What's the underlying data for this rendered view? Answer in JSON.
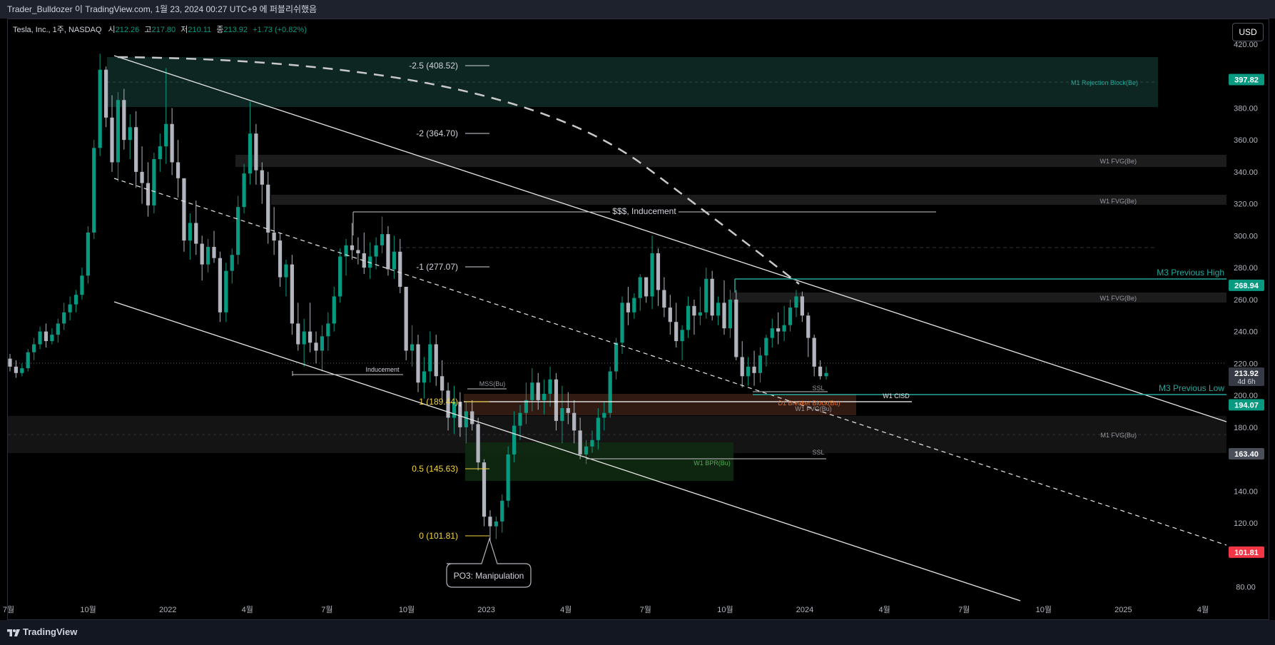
{
  "window": {
    "title": "Trader_Bulldozer 이 TradingView.com, 1월 23, 2024 00:27 UTC+9 에 퍼블리쉬했음"
  },
  "branding": {
    "logo_text": "TradingView"
  },
  "currency_button": "USD",
  "colors": {
    "up": "#089981",
    "down": "#b2b5be",
    "teal": "#26a69a",
    "fib": "#f5d442",
    "white_line": "#e6e6e6",
    "red_label": "#f23645",
    "grey_label": "#6a6d78"
  },
  "chart_data": {
    "type": "candlestick",
    "symbol_line": {
      "name": "Tesla, Inc., 1주, NASDAQ",
      "o_label": "시",
      "o_value": "212.26",
      "h_label": "고",
      "h_value": "217.80",
      "l_label": "저",
      "l_value": "210.11",
      "c_label": "종",
      "c_value": "213.92",
      "change": "+1.73 (+0.82%)"
    },
    "ylim": [
      70,
      428
    ],
    "y_ticks": [
      "420.00",
      "380.00",
      "360.00",
      "340.00",
      "320.00",
      "300.00",
      "280.00",
      "260.00",
      "240.00",
      "220.00",
      "200.00",
      "180.00",
      "140.00",
      "120.00",
      "80.00"
    ],
    "x_ticks": [
      "7월",
      "10월",
      "2022",
      "4월",
      "7월",
      "10월",
      "2023",
      "4월",
      "7월",
      "10월",
      "2024",
      "4월",
      "7월",
      "10월",
      "2025",
      "4월"
    ],
    "price_labels": [
      {
        "text": "397.82",
        "value": 397.82,
        "color": "#089981"
      },
      {
        "text": "268.94",
        "value": 268.94,
        "color": "#089981"
      },
      {
        "text": "213.92",
        "value": 213.92,
        "color": "#363a45",
        "sub": "4d 6h"
      },
      {
        "text": "194.07",
        "value": 194.07,
        "color": "#089981"
      },
      {
        "text": "163.40",
        "value": 163.4,
        "color": "#4a4e59"
      },
      {
        "text": "101.81",
        "value": 101.81,
        "color": "#f23645"
      }
    ],
    "fib_labels": [
      {
        "text": "-2.5 (408.52)",
        "value": 408.52,
        "color": "#d1d4dc"
      },
      {
        "text": "-2 (364.70)",
        "value": 364.7,
        "color": "#d1d4dc"
      },
      {
        "text": "-1 (277.07)",
        "value": 277.07,
        "color": "#d1d4dc"
      },
      {
        "text": "1 (189.44)",
        "value": 189.44,
        "color": "#f5d442"
      },
      {
        "text": "0.5 (145.63)",
        "value": 145.63,
        "color": "#f5d442"
      },
      {
        "text": "0 (101.81)",
        "value": 101.81,
        "color": "#f5d442"
      }
    ],
    "annotations": {
      "m1_rejection": "M1 Rejection Block(Be)",
      "w1_fvg_be": "W1 FVG(Be)",
      "sss_inducement": "$$$, Inducement",
      "m3_prev_high": "M3 Previous High",
      "m3_prev_low": "M3 Previous Low",
      "inducement": "Inducement",
      "mss_bu": "MSS(Bu)",
      "ssl": "SSL",
      "w1_cisd": "W1 CISD",
      "d1_breaker": "D1 Breaker Block(Bu)",
      "w1_fvg_bu": "W1 FVG(Bu)",
      "m1_fvg_bu": "M1 FVG(Bu)",
      "w1_bpr_bu": "W1 BPR(Bu)",
      "po3": "PO3: Manipulation"
    },
    "candles": [
      [
        223,
        226,
        215,
        218
      ],
      [
        218,
        222,
        211,
        214
      ],
      [
        214,
        220,
        212,
        217
      ],
      [
        217,
        229,
        215,
        227
      ],
      [
        227,
        236,
        222,
        232
      ],
      [
        232,
        243,
        229,
        240
      ],
      [
        240,
        245,
        230,
        234
      ],
      [
        234,
        242,
        232,
        238
      ],
      [
        238,
        248,
        233,
        245
      ],
      [
        245,
        258,
        241,
        252
      ],
      [
        252,
        262,
        247,
        257
      ],
      [
        257,
        266,
        252,
        263
      ],
      [
        263,
        280,
        260,
        275
      ],
      [
        275,
        306,
        270,
        302
      ],
      [
        302,
        360,
        298,
        355
      ],
      [
        355,
        414,
        350,
        404
      ],
      [
        404,
        406,
        368,
        374
      ],
      [
        374,
        388,
        340,
        346
      ],
      [
        346,
        390,
        334,
        385
      ],
      [
        385,
        392,
        354,
        360
      ],
      [
        360,
        376,
        348,
        368
      ],
      [
        368,
        378,
        330,
        340
      ],
      [
        340,
        356,
        320,
        333
      ],
      [
        333,
        346,
        312,
        319
      ],
      [
        319,
        352,
        314,
        348
      ],
      [
        348,
        364,
        340,
        356
      ],
      [
        356,
        405,
        345,
        370
      ],
      [
        370,
        380,
        338,
        346
      ],
      [
        346,
        360,
        324,
        336
      ],
      [
        336,
        318,
        290,
        297
      ],
      [
        297,
        314,
        285,
        308
      ],
      [
        308,
        322,
        288,
        295
      ],
      [
        295,
        300,
        272,
        282
      ],
      [
        282,
        298,
        277,
        293
      ],
      [
        293,
        303,
        283,
        286
      ],
      [
        286,
        290,
        246,
        252
      ],
      [
        252,
        283,
        246,
        278
      ],
      [
        278,
        292,
        270,
        288
      ],
      [
        288,
        325,
        282,
        318
      ],
      [
        318,
        345,
        314,
        339
      ],
      [
        339,
        384,
        332,
        364
      ],
      [
        364,
        370,
        332,
        341
      ],
      [
        341,
        346,
        320,
        332
      ],
      [
        332,
        340,
        295,
        302
      ],
      [
        302,
        318,
        288,
        297
      ],
      [
        297,
        302,
        268,
        274
      ],
      [
        274,
        285,
        262,
        282
      ],
      [
        282,
        288,
        238,
        245
      ],
      [
        245,
        258,
        228,
        232
      ],
      [
        232,
        248,
        218,
        240
      ],
      [
        240,
        258,
        227,
        233
      ],
      [
        233,
        240,
        220,
        228
      ],
      [
        228,
        244,
        215,
        237
      ],
      [
        237,
        252,
        228,
        245
      ],
      [
        245,
        268,
        240,
        262
      ],
      [
        262,
        292,
        258,
        287
      ],
      [
        287,
        298,
        275,
        294
      ],
      [
        294,
        308,
        285,
        291
      ],
      [
        291,
        299,
        282,
        289
      ],
      [
        289,
        302,
        276,
        280
      ],
      [
        280,
        296,
        273,
        287
      ],
      [
        287,
        299,
        279,
        294
      ],
      [
        294,
        312,
        289,
        301
      ],
      [
        301,
        306,
        275,
        279
      ],
      [
        279,
        300,
        273,
        290
      ],
      [
        290,
        298,
        264,
        268
      ],
      [
        268,
        256,
        222,
        228
      ],
      [
        228,
        244,
        218,
        232
      ],
      [
        232,
        238,
        202,
        208
      ],
      [
        208,
        224,
        198,
        215
      ],
      [
        215,
        240,
        208,
        232
      ],
      [
        232,
        238,
        206,
        212
      ],
      [
        212,
        222,
        196,
        203
      ],
      [
        203,
        208,
        178,
        186
      ],
      [
        186,
        206,
        176,
        196
      ],
      [
        196,
        202,
        174,
        180
      ],
      [
        180,
        196,
        170,
        190
      ],
      [
        190,
        197,
        178,
        182
      ],
      [
        182,
        186,
        153,
        158
      ],
      [
        158,
        160,
        118,
        124
      ],
      [
        124,
        128,
        108,
        118
      ],
      [
        118,
        124,
        110,
        121
      ],
      [
        121,
        138,
        114,
        134
      ],
      [
        134,
        168,
        130,
        163
      ],
      [
        163,
        190,
        158,
        181
      ],
      [
        181,
        194,
        172,
        189
      ],
      [
        189,
        208,
        182,
        197
      ],
      [
        197,
        217,
        190,
        208
      ],
      [
        208,
        214,
        191,
        197
      ],
      [
        197,
        210,
        188,
        201
      ],
      [
        201,
        218,
        193,
        210
      ],
      [
        210,
        214,
        178,
        184
      ],
      [
        184,
        206,
        170,
        192
      ],
      [
        192,
        202,
        182,
        189
      ],
      [
        189,
        197,
        170,
        178
      ],
      [
        178,
        186,
        160,
        163
      ],
      [
        163,
        172,
        157,
        168
      ],
      [
        168,
        178,
        164,
        172
      ],
      [
        172,
        192,
        166,
        186
      ],
      [
        186,
        196,
        178,
        189
      ],
      [
        189,
        218,
        186,
        215
      ],
      [
        215,
        236,
        210,
        233
      ],
      [
        233,
        262,
        226,
        258
      ],
      [
        258,
        268,
        244,
        252
      ],
      [
        252,
        264,
        248,
        261
      ],
      [
        261,
        276,
        253,
        274
      ],
      [
        274,
        272,
        258,
        262
      ],
      [
        262,
        300,
        254,
        289
      ],
      [
        289,
        292,
        256,
        266
      ],
      [
        266,
        274,
        249,
        255
      ],
      [
        255,
        263,
        238,
        246
      ],
      [
        246,
        258,
        230,
        234
      ],
      [
        234,
        244,
        222,
        241
      ],
      [
        241,
        262,
        236,
        256
      ],
      [
        256,
        260,
        238,
        250
      ],
      [
        250,
        268,
        244,
        252
      ],
      [
        252,
        280,
        248,
        273
      ],
      [
        273,
        278,
        247,
        250
      ],
      [
        250,
        262,
        244,
        258
      ],
      [
        258,
        272,
        238,
        242
      ],
      [
        242,
        266,
        236,
        260
      ],
      [
        260,
        266,
        222,
        224
      ],
      [
        224,
        234,
        205,
        212
      ],
      [
        212,
        224,
        206,
        218
      ],
      [
        218,
        228,
        206,
        214
      ],
      [
        214,
        230,
        208,
        225
      ],
      [
        225,
        238,
        218,
        236
      ],
      [
        236,
        248,
        230,
        242
      ],
      [
        242,
        252,
        232,
        240
      ],
      [
        240,
        256,
        234,
        244
      ],
      [
        244,
        260,
        240,
        255
      ],
      [
        255,
        266,
        249,
        262
      ],
      [
        262,
        265,
        246,
        250
      ],
      [
        250,
        252,
        224,
        236
      ],
      [
        236,
        238,
        212,
        218
      ],
      [
        218,
        222,
        210,
        212
      ],
      [
        212,
        218,
        210,
        214
      ]
    ]
  }
}
